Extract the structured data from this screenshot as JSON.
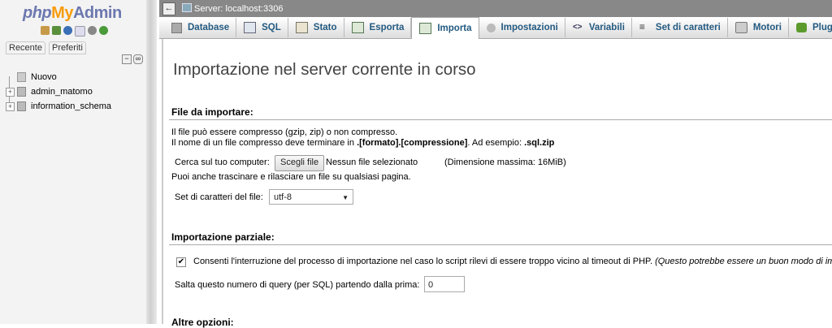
{
  "logo": {
    "php": "php",
    "my": "My",
    "admin": "Admin"
  },
  "sidebar": {
    "tabs": [
      "Recente",
      "Preferiti"
    ],
    "tree": [
      {
        "label": "Nuovo",
        "expander": ""
      },
      {
        "label": "admin_matomo",
        "expander": "+"
      },
      {
        "label": "information_schema",
        "expander": "+"
      }
    ]
  },
  "topbar": {
    "server": "Server: localhost:3306"
  },
  "tabs": [
    {
      "label": "Database",
      "icon": "database-icon"
    },
    {
      "label": "SQL",
      "icon": "sql-icon"
    },
    {
      "label": "Stato",
      "icon": "status-icon"
    },
    {
      "label": "Esporta",
      "icon": "export-icon"
    },
    {
      "label": "Importa",
      "icon": "import-icon"
    },
    {
      "label": "Impostazioni",
      "icon": "settings-icon"
    },
    {
      "label": "Variabili",
      "icon": "variables-icon"
    },
    {
      "label": "Set di caratteri",
      "icon": "charset-icon"
    },
    {
      "label": "Motori",
      "icon": "engines-icon"
    },
    {
      "label": "Plugin",
      "icon": "plugin-icon"
    }
  ],
  "page": {
    "title": "Importazione nel server corrente in corso",
    "file_section": {
      "legend": "File da importare:",
      "line1": "Il file può essere compresso (gzip, zip) o non compresso.",
      "line2_prefix": "Il nome di un file compresso deve terminare in ",
      "line2_pattern": ".[formato].[compressione]",
      "line2_mid": ". Ad esempio: ",
      "line2_example": ".sql.zip",
      "browse_label": "Cerca sul tuo computer:",
      "choose_button": "Scegli file",
      "no_file": "Nessun file selezionato",
      "max_size": "(Dimensione massima: 16MiB)",
      "drag_hint": "Puoi anche trascinare e rilasciare un file su qualsiasi pagina.",
      "charset_label": "Set di caratteri del file:",
      "charset_value": "utf-8"
    },
    "partial_section": {
      "legend": "Importazione parziale:",
      "allow_interrupt": "Consenti l'interruzione del processo di importazione nel caso lo script rilevi di essere troppo vicino al timeout di PHP.",
      "allow_interrupt_note": "(Questo potrebbe essere un buon modo di impo",
      "skip_label": "Salta questo numero di query (per SQL) partendo dalla prima:",
      "skip_value": "0"
    },
    "other_section": {
      "legend": "Altre opzioni:"
    }
  }
}
